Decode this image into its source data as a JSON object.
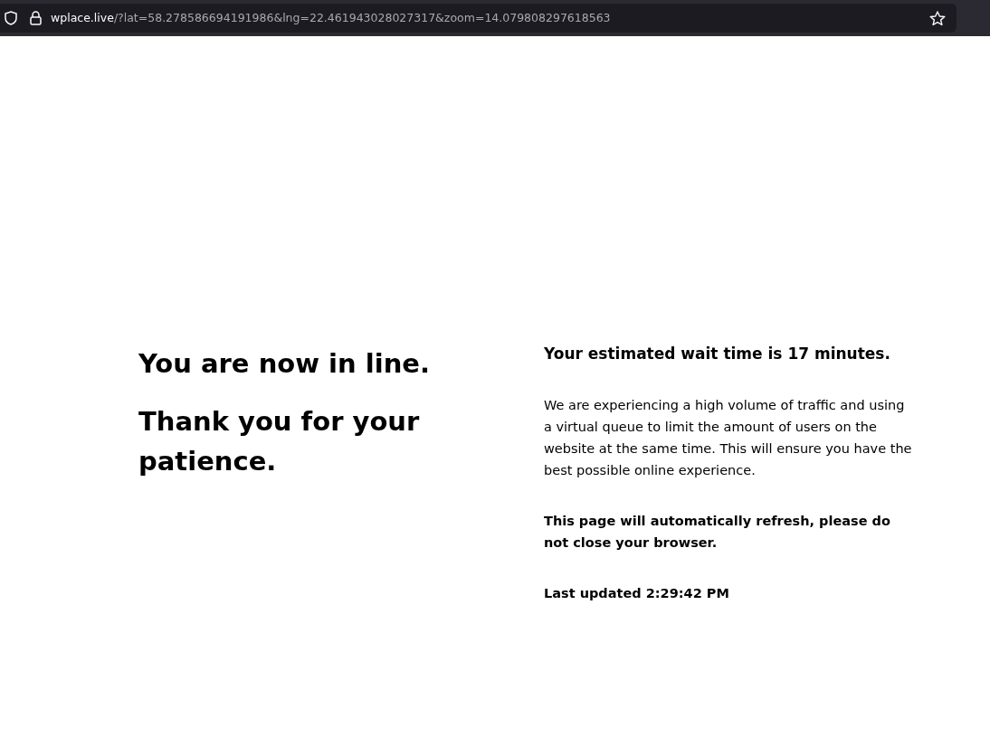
{
  "address_bar": {
    "domain": "wplace.live",
    "path": "/?lat=58.278586694191986&lng=22.461943028027317&zoom=14.079808297618563"
  },
  "left": {
    "headings": [
      "You are now in line.",
      "Thank you for your patience."
    ]
  },
  "right": {
    "wait_time": "Your estimated wait time is 17 minutes.",
    "message": "We are experiencing a high volume of traffic and using a virtual queue to limit the amount of users on the website at the same time. This will ensure you have the best possible online experience.",
    "refresh_notice": "This page will automatically refresh, please do not close your browser.",
    "last_updated": "Last updated 2:29:42 PM"
  }
}
